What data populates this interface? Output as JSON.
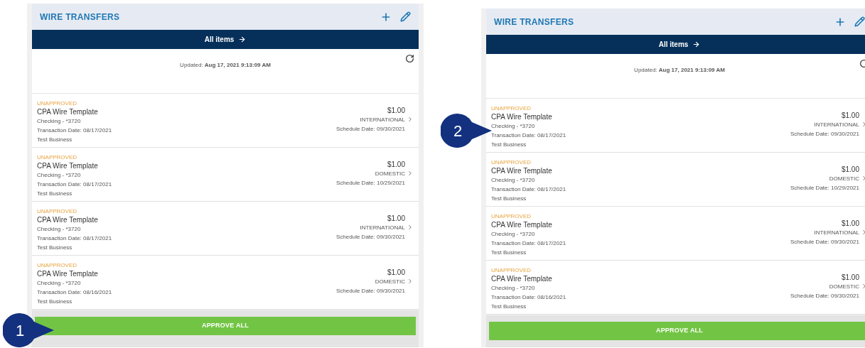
{
  "panels": [
    {
      "title": "WIRE TRANSFERS",
      "all_items": "All items",
      "updated": "Updated: **Aug 17, 2021 9:13:09 AM**",
      "transfers": [
        {
          "status": "UNAPPROVED",
          "name": "CPA Wire Template",
          "account": "Checking - *3720",
          "transaction_date": "Transaction Date: 08/17/2021",
          "business": "Test Business",
          "amount": "$1.00",
          "type": "INTERNATIONAL",
          "schedule_date": "Schedule Date: 09/30/2021"
        },
        {
          "status": "UNAPPROVED",
          "name": "CPA Wire Template",
          "account": "Checking - *3720",
          "transaction_date": "Transaction Date: 08/17/2021",
          "business": "Test Business",
          "amount": "$1.00",
          "type": "DOMESTIC",
          "schedule_date": "Schedule Date: 10/29/2021"
        },
        {
          "status": "UNAPPROVED",
          "name": "CPA Wire Template",
          "account": "Checking - *3720",
          "transaction_date": "Transaction Date: 08/17/2021",
          "business": "Test Business",
          "amount": "$1.00",
          "type": "INTERNATIONAL",
          "schedule_date": "Schedule Date: 09/30/2021"
        },
        {
          "status": "UNAPPROVED",
          "name": "CPA Wire Template",
          "account": "Checking - *3720",
          "transaction_date": "Transaction Date: 08/16/2021",
          "business": "Test Business",
          "amount": "$1.00",
          "type": "DOMESTIC",
          "schedule_date": "Schedule Date: 09/30/2021"
        }
      ],
      "approve_button": "APPROVE ALL"
    },
    {
      "title": "WIRE TRANSFERS",
      "all_items": "All items",
      "updated": "Updated: **Aug 17, 2021 9:13:09 AM**",
      "transfers": [
        {
          "status": "UNAPPROVED",
          "name": "CPA Wire Template",
          "account": "Checking - *3720",
          "transaction_date": "Transaction Date: 08/17/2021",
          "business": "Test Business",
          "amount": "$1.00",
          "type": "INTERNATIONAL",
          "schedule_date": "Schedule Date: 09/30/2021"
        },
        {
          "status": "UNAPPROVED",
          "name": "CPA Wire Template",
          "account": "Checking - *3720",
          "transaction_date": "Transaction Date: 08/17/2021",
          "business": "Test Business",
          "amount": "$1.00",
          "type": "DOMESTIC",
          "schedule_date": "Schedule Date: 10/29/2021"
        },
        {
          "status": "UNAPPROVED",
          "name": "CPA Wire Template",
          "account": "Checking - *3720",
          "transaction_date": "Transaction Date: 08/17/2021",
          "business": "Test Business",
          "amount": "$1.00",
          "type": "INTERNATIONAL",
          "schedule_date": "Schedule Date: 09/30/2021"
        },
        {
          "status": "UNAPPROVED",
          "name": "CPA Wire Template",
          "account": "Checking - *3720",
          "transaction_date": "Transaction Date: 08/16/2021",
          "business": "Test Business",
          "amount": "$1.00",
          "type": "DOMESTIC",
          "schedule_date": "Schedule Date: 09/30/2021"
        }
      ],
      "approve_button": "APPROVE ALL"
    }
  ],
  "callouts": [
    {
      "label": "1"
    },
    {
      "label": "2"
    }
  ]
}
